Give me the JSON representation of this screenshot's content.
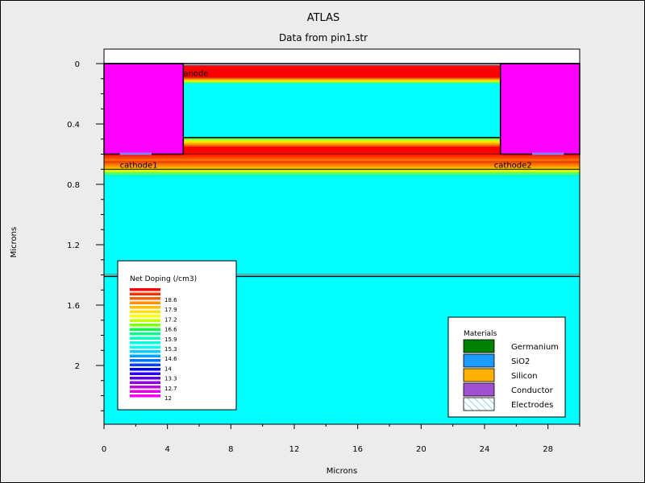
{
  "title": "ATLAS",
  "subtitle": "Data from pin1.str",
  "xlabel": "Microns",
  "ylabel": "Microns",
  "chart_data": {
    "type": "heatmap",
    "xlim": [
      0,
      30
    ],
    "ylim": [
      0,
      2.4
    ],
    "y_inverted": true,
    "x_ticks": [
      "0",
      "4",
      "8",
      "12",
      "16",
      "20",
      "24",
      "28"
    ],
    "x_tick_values": [
      0,
      4,
      8,
      12,
      16,
      20,
      24,
      28
    ],
    "y_ticks": [
      "0",
      "0.4",
      "0.8",
      "1.2",
      "1.6",
      "2"
    ],
    "y_tick_values": [
      0,
      0.4,
      0.8,
      1.2,
      1.6,
      2.0
    ],
    "electrode_labels": [
      {
        "text": "anode",
        "x": 5.0,
        "y": 0.06
      },
      {
        "text": "cathode1",
        "x": 1.0,
        "y": 0.67
      },
      {
        "text": "cathode2",
        "x": 24.6,
        "y": 0.67
      }
    ],
    "regions": {
      "conductor_pads": [
        {
          "x0": 0,
          "x1": 5,
          "y0": 0,
          "y1": 0.6
        },
        {
          "x0": 25,
          "x1": 30,
          "y0": 0,
          "y1": 0.6
        }
      ],
      "anode_layer": {
        "x0": 5,
        "x1": 25,
        "y0": 0,
        "y1": 0.13
      },
      "intrinsic_top": {
        "x0": 5,
        "x1": 25,
        "y0": 0.13,
        "y1": 0.49
      },
      "buried_layer": {
        "x0": 5,
        "x1": 25,
        "y0": 0.49,
        "y1": 0.6
      },
      "cathode_layer": {
        "x0": 0,
        "x1": 30,
        "y0": 0.6,
        "y1": 0.75
      },
      "substrate_upper": {
        "x0": 0,
        "x1": 30,
        "y0": 0.75,
        "y1": 1.4
      },
      "substrate_lower": {
        "x0": 0,
        "x1": 30,
        "y0": 1.4,
        "y1": 2.4
      }
    },
    "doping_legend": {
      "title": "Net Doping (/cm3)",
      "labels": [
        "18.6",
        "17.9",
        "17.2",
        "16.6",
        "15.9",
        "15.3",
        "14.6",
        "14",
        "13.3",
        "12.7",
        "12"
      ],
      "colors": [
        "#ff0000",
        "#ff3000",
        "#ff6000",
        "#ff9000",
        "#ffbf00",
        "#ffe000",
        "#ffff00",
        "#c0ff00",
        "#80ff00",
        "#00ff40",
        "#00ff90",
        "#00ffc0",
        "#00ffe0",
        "#00ffff",
        "#00d0ff",
        "#00a0ff",
        "#0070ff",
        "#0040ff",
        "#0000ff",
        "#3000ff",
        "#6000e0",
        "#9000e0",
        "#c000e0",
        "#e000e0",
        "#ff00ff"
      ]
    },
    "materials_legend": {
      "title": "Materials",
      "items": [
        {
          "name": "Germanium",
          "color": "#008000"
        },
        {
          "name": "SiO2",
          "color": "#1e9bff"
        },
        {
          "name": "Silicon",
          "color": "#ffb000"
        },
        {
          "name": "Conductor",
          "color": "#a050d0"
        },
        {
          "name": "Electrodes",
          "color": "#ffffff",
          "hatch": true
        }
      ]
    },
    "colors": {
      "substrate": "#00ffff",
      "conductor": "#ff00ff",
      "background": "#ffffff",
      "contact": "#8080ff"
    }
  }
}
